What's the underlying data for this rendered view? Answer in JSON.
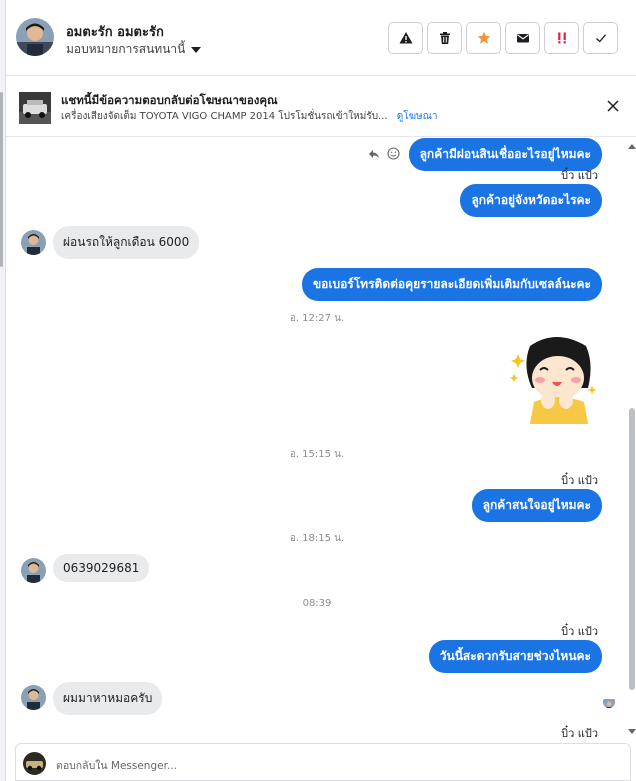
{
  "header": {
    "contact_name": "อมตะรัก อมตะรัก",
    "assign_label": "มอบหมายการสนทนานี้",
    "actions": [
      "alert-icon",
      "trash-icon",
      "star-icon",
      "mail-icon",
      "important-icon",
      "check-icon"
    ]
  },
  "ad_banner": {
    "title": "แชทนี้มีข้อความตอบกลับต่อโฆษณาของคุณ",
    "subtitle": "เครื่องเสียงจัดเต็ม TOYOTA VIGO CHAMP 2014 โปรโมชั่นรถเข้าใหม่รับ...",
    "link": "ดูโฆษณา"
  },
  "thread": {
    "messages": [
      {
        "type": "out",
        "text": "ลูกค้ามีผ่อนสินเชื่ออะไรอยู่ไหมคะ"
      },
      {
        "type": "sender",
        "text": "บิ๋ว แป้ว"
      },
      {
        "type": "out",
        "text": "ลูกค้าอยู่จังหวัดอะไรคะ"
      },
      {
        "type": "in",
        "text": "ผ่อนรถให้ลูกเดือน 6000"
      },
      {
        "type": "out",
        "text": "ขอเบอร์โทรติดต่อคุยรายละเอียดเพิ่มเติมกับเซลล์นะคะ"
      },
      {
        "type": "time",
        "text": "อ. 12:27 น."
      },
      {
        "type": "sticker",
        "text": "sticker-girl-happy"
      },
      {
        "type": "time",
        "text": "อ. 15:15 น."
      },
      {
        "type": "sender",
        "text": "บิ๋ว แป้ว"
      },
      {
        "type": "out",
        "text": "ลูกค้าสนใจอยู่ไหมคะ"
      },
      {
        "type": "time",
        "text": "อ. 18:15 น."
      },
      {
        "type": "in",
        "text": "0639029681"
      },
      {
        "type": "time",
        "text": "08:39"
      },
      {
        "type": "sender",
        "text": "บิ๋ว แป้ว"
      },
      {
        "type": "out",
        "text": "วันนี้สะดวกรับสายช่วงไหนคะ"
      },
      {
        "type": "in",
        "text": "ผมมาหาหมอครับ"
      },
      {
        "type": "sender",
        "text": "บิ๋ว แป้ว"
      }
    ]
  },
  "composer": {
    "placeholder": "ตอบกลับใน Messenger..."
  },
  "colors": {
    "outgoing_bubble": "#1b74e4",
    "incoming_bubble": "#e9eaec",
    "accent_star": "#f7923b",
    "important": "#e41e3f"
  }
}
